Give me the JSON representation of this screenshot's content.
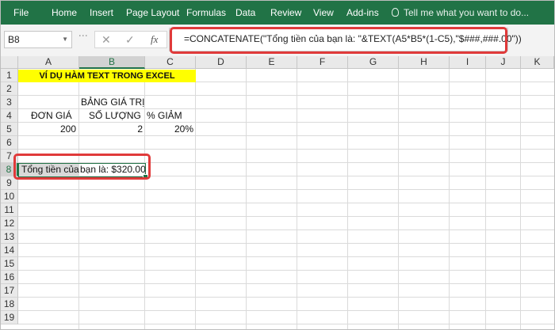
{
  "ribbon": {
    "tabs": [
      "File",
      "Home",
      "Insert",
      "Page Layout",
      "Formulas",
      "Data",
      "Review",
      "View",
      "Add-ins"
    ],
    "tell_me": "Tell me what you want to do..."
  },
  "formula_bar": {
    "name_box": "B8",
    "fx_label": "fx",
    "formula": "=CONCATENATE(\"Tổng tiền của bạn là: \"&TEXT(A5*B5*(1-C5),\"$###,###.00\"))"
  },
  "grid": {
    "columns": [
      "A",
      "B",
      "C",
      "D",
      "E",
      "F",
      "G",
      "H",
      "I",
      "J",
      "K"
    ],
    "rows": [
      "1",
      "2",
      "3",
      "4",
      "5",
      "6",
      "7",
      "8",
      "9",
      "10",
      "11",
      "12",
      "13",
      "14",
      "15",
      "16",
      "17",
      "18",
      "19"
    ],
    "selected_cell": "B8",
    "cells": {
      "a1_title": "VÍ DỤ HÀM TEXT TRONG EXCEL",
      "b3": "BẢNG GIÁ TRỊ",
      "a4": "ĐƠN GIÁ",
      "b4": "SỐ LƯỢNG",
      "c4": "% GIẢM",
      "a5": "200",
      "b5": "2",
      "c5": "20%",
      "a8": "Tổng tiền của",
      "b8": "bạn là: $320.00"
    }
  },
  "colors": {
    "ribbon": "#217346",
    "highlight": "#ffff00",
    "annotation": "#e03a3a"
  }
}
